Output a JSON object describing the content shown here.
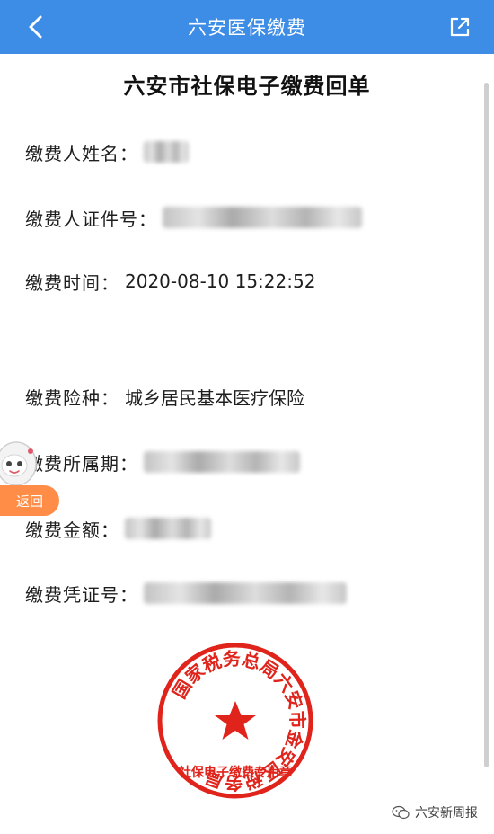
{
  "header": {
    "title": "六安医保缴费",
    "back_icon": "chevron-left-icon",
    "share_icon": "share-icon",
    "bg_color": "#3d8ce5"
  },
  "document": {
    "title": "六安市社保电子缴费回单",
    "fields": {
      "payer_name": {
        "label": "缴费人姓名："
      },
      "payer_id": {
        "label": "缴费人证件号："
      },
      "pay_time": {
        "label": "缴费时间：",
        "value": "2020-08-10 15:22:52"
      },
      "insurance_type": {
        "label": "缴费险种：",
        "value": "城乡居民基本医疗保险"
      },
      "period": {
        "label": "缴费所属期："
      },
      "amount": {
        "label": "缴费金额："
      },
      "voucher_no": {
        "label": "缴费凭证号："
      }
    }
  },
  "floating": {
    "back_label": "返回",
    "back_color": "#ff8d47"
  },
  "seal": {
    "outer_text": "国家税务总局六安市金安区税务局",
    "inner_text": "社保电子缴费专用章",
    "color": "#e0241b",
    "star_icon": "star-icon"
  },
  "watermark": {
    "text": "六安新周报",
    "icon": "wechat-icon"
  }
}
